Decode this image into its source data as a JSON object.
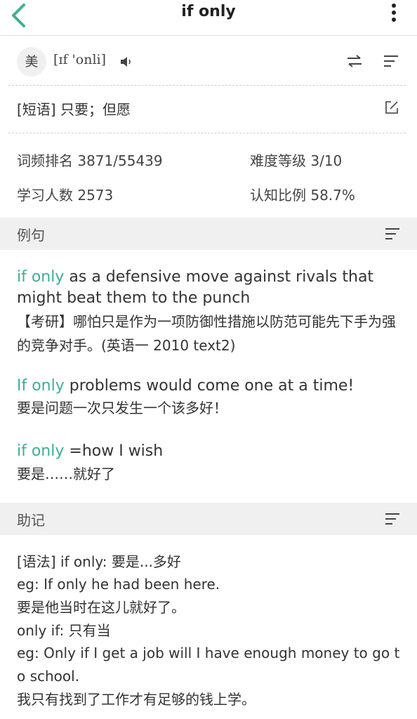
{
  "nav": {
    "title": "if only",
    "back_icon": "chevron-left-icon",
    "more_icon": "more-vertical-icon"
  },
  "pronunciation": {
    "region": "美",
    "ipa": "[ɪf 'onli]",
    "speaker_icon": "speaker-icon",
    "swap_icon": "swap-icon",
    "lines_icon": "lines-icon"
  },
  "meaning": {
    "text": "[短语] 只要；但愿",
    "edit_icon": "edit-icon"
  },
  "stats": {
    "freq_rank": "词频排名 3871/55439",
    "difficulty": "难度等级 3/10",
    "learners": "学习人数 2573",
    "cognition": "认知比例 58.7%"
  },
  "examples_section": {
    "label": "例句"
  },
  "examples": [
    {
      "highlight": "if only",
      "rest": " as a defensive move against rivals that might beat them to the punch",
      "translation": "【考研】哪怕只是作为一项防御性措施以防范可能先下手为强的竞争对手。(英语一 2010 text2)"
    },
    {
      "highlight": "If only",
      "rest": " problems would come one at a time!",
      "translation": "要是问题一次只发生一个该多好！"
    },
    {
      "highlight": "if only",
      "rest": " =how I wish",
      "translation": "要是……就好了"
    }
  ],
  "mnemonic_section": {
    "label": "助记"
  },
  "mnemonic": {
    "lines": [
      "[语法] if only: 要是...多好",
      "eg: If only he had been here.",
      "要是他当时在这儿就好了。",
      "only if: 只有当",
      "eg: Only if I get a job will I have enough money to go t",
      "o school.",
      "我只有找到了工作才有足够的钱上学。"
    ]
  },
  "colors": {
    "accent": "#3fae97",
    "section_bg": "#f0f0f0"
  }
}
